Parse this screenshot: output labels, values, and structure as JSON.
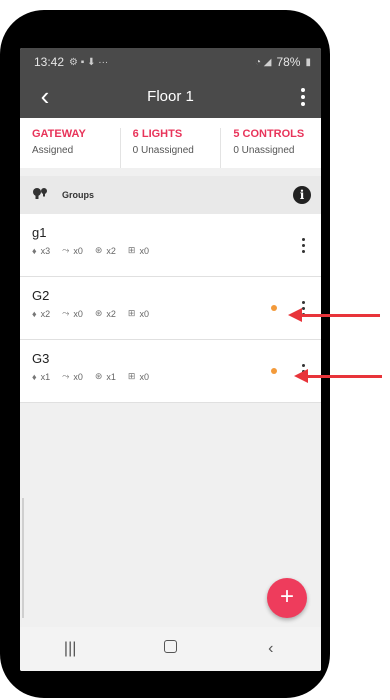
{
  "status_bar": {
    "time": "13:42",
    "battery": "78%"
  },
  "app_bar": {
    "title": "Floor 1"
  },
  "stats": [
    {
      "label": "GATEWAY",
      "sub": "Assigned"
    },
    {
      "label": "6 LIGHTS",
      "sub": "0 Unassigned"
    },
    {
      "label": "5 CONTROLS",
      "sub": "0 Unassigned"
    }
  ],
  "groups_header": {
    "title": "Groups"
  },
  "groups": [
    {
      "name": "g1",
      "lights": "x3",
      "switches": "x0",
      "sensors": "x2",
      "buttons": "x0",
      "has_dot": false
    },
    {
      "name": "G2",
      "lights": "x2",
      "switches": "x0",
      "sensors": "x2",
      "buttons": "x0",
      "has_dot": true
    },
    {
      "name": "G3",
      "lights": "x1",
      "switches": "x0",
      "sensors": "x1",
      "buttons": "x0",
      "has_dot": true
    }
  ],
  "colors": {
    "accent": "#e8345a",
    "status_dot": "#f39a3a",
    "arrow": "#e8343a",
    "app_bar": "#4a4a4a"
  }
}
